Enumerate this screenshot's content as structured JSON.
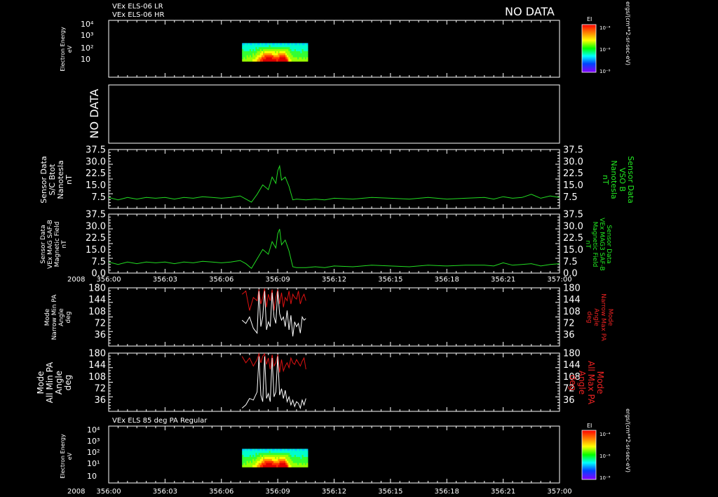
{
  "header": {
    "instrument_lines": [
      "VEx ELS-06 LR",
      "VEx ELS-06 HR"
    ],
    "status": "NO DATA"
  },
  "colors": {
    "frame": "#ffffff",
    "mag_trace": "#22dd22",
    "min_pa_trace": "#ffffff",
    "max_pa_trace": "#dd1111",
    "right_label_green": "#22ee22",
    "right_label_red": "#ee2222"
  },
  "time_axis": {
    "year": "2008",
    "tick_labels": [
      "356:00",
      "356:03",
      "356:06",
      "356:09",
      "356:12",
      "356:15",
      "356:18",
      "356:21",
      "357:00"
    ]
  },
  "chart_data": [
    {
      "type": "heatmap",
      "ylabel": [
        "Electron Energy",
        "eV"
      ],
      "y_tick_labels": [
        "10",
        "10²",
        "10³",
        "10⁴"
      ],
      "y_scale": "log",
      "colorbar": {
        "title": "EI",
        "tick_labels": [
          "10⁻⁴",
          "10⁻⁶",
          "10⁻⁸"
        ]
      },
      "colorbar_units": "ergs/(cm**2-sr-sec-eV)",
      "x_range": [
        "356:07.1",
        "356:10.6"
      ],
      "y_range_eV": [
        10,
        200
      ]
    },
    {
      "type": "line",
      "panel_text": "NO DATA"
    },
    {
      "type": "line",
      "left_label": [
        "Sensor Data",
        "S/C Btot",
        "Nanotesla",
        "nT"
      ],
      "right_label": [
        "Sensor Data",
        "VSO B",
        "Nanotesla",
        "nT"
      ],
      "y_tick_labels": [
        "37.5",
        "30.0",
        "22.5",
        "15.0",
        "7.5"
      ],
      "ylim": [
        0,
        37.5
      ],
      "series": [
        {
          "x_min": [
            0,
            0.5,
            1,
            1.5,
            2,
            2.5,
            3,
            3.5,
            4,
            4.5,
            5,
            5.5,
            6,
            6.5,
            7,
            7.3,
            7.6,
            7.9,
            8.2,
            8.5,
            8.7,
            8.9,
            9.0,
            9.1,
            9.2,
            9.4,
            9.6,
            9.8,
            10,
            10.5,
            11,
            11.5,
            12,
            13,
            14,
            15,
            16,
            17,
            18,
            19,
            20,
            20.5,
            21,
            21.5,
            22,
            22.5,
            23,
            23.5,
            24
          ],
          "values": [
            7,
            5.5,
            7,
            6,
            7,
            6.5,
            7,
            6,
            7,
            6.5,
            7.5,
            7,
            6.5,
            7,
            8,
            6,
            4,
            9,
            15,
            12,
            20,
            16,
            24,
            27,
            18,
            20,
            14,
            5.5,
            6,
            5.5,
            6,
            5.5,
            6.5,
            6,
            7,
            6.5,
            6,
            7,
            6,
            6.5,
            7,
            6,
            7.5,
            6.5,
            7,
            9,
            6.5,
            8,
            7
          ]
        }
      ]
    },
    {
      "type": "line",
      "left_label": [
        "Sensor Data",
        "VEx MAG SAF-B",
        "Magnetic Field",
        "nT"
      ],
      "right_label": [
        "Sensor Data",
        "VEx MAG3 SAF-B",
        "Magnetic Field",
        "nT"
      ],
      "y_tick_labels": [
        "37.5",
        "30.0",
        "22.5",
        "15.0",
        "7.5",
        "0.0"
      ],
      "ylim": [
        0,
        37.5
      ],
      "series": [
        {
          "x_min": [
            0,
            0.5,
            1,
            1.5,
            2,
            2.5,
            3,
            3.5,
            4,
            4.5,
            5,
            5.5,
            6,
            6.5,
            7,
            7.3,
            7.6,
            7.9,
            8.2,
            8.5,
            8.7,
            8.9,
            9.0,
            9.1,
            9.2,
            9.4,
            9.6,
            9.8,
            10,
            10.5,
            11,
            11.5,
            12,
            13,
            14,
            15,
            16,
            17,
            18,
            19,
            20,
            20.5,
            21,
            21.5,
            22,
            22.5,
            23,
            23.5,
            24
          ],
          "values": [
            7,
            5.5,
            7,
            6,
            7,
            6.5,
            7,
            6,
            7,
            6.5,
            7.5,
            7,
            6.5,
            7,
            8,
            6,
            3,
            9,
            15,
            12,
            20,
            16,
            25,
            28,
            18,
            21,
            14,
            4,
            3.5,
            3.5,
            4,
            3.5,
            4.5,
            4,
            5,
            4.5,
            4,
            5,
            4.5,
            5,
            5,
            4.5,
            6.5,
            5,
            5.5,
            6,
            4.5,
            5.5,
            6
          ]
        }
      ]
    },
    {
      "type": "line",
      "left_label": [
        "Mode",
        "Narrow Min PA",
        "Angle",
        "deg"
      ],
      "right_label": [
        "Mode",
        "Narrow Max PA",
        "Angle",
        "deg"
      ],
      "y_tick_labels": [
        "180",
        "144",
        "108",
        "72",
        "36"
      ],
      "ylim": [
        0,
        180
      ],
      "series": [
        {
          "x_min": [
            7.1,
            7.3,
            7.5,
            7.7,
            7.9,
            8.0,
            8.1,
            8.2,
            8.3,
            8.4,
            8.5,
            8.6,
            8.7,
            8.8,
            8.9,
            9.0,
            9.1,
            9.2,
            9.3,
            9.4,
            9.5,
            9.6,
            9.7,
            9.8,
            9.9,
            10.0,
            10.1,
            10.2,
            10.3,
            10.4,
            10.5
          ],
          "values": [
            80,
            70,
            90,
            55,
            40,
            170,
            60,
            90,
            170,
            50,
            75,
            60,
            165,
            90,
            70,
            170,
            100,
            80,
            90,
            60,
            110,
            50,
            95,
            30,
            75,
            60,
            70,
            40,
            90,
            80,
            85
          ]
        },
        {
          "x_min": [
            7.1,
            7.3,
            7.5,
            7.7,
            7.9,
            8.0,
            8.1,
            8.2,
            8.3,
            8.4,
            8.5,
            8.6,
            8.7,
            8.8,
            8.9,
            9.0,
            9.1,
            9.2,
            9.3,
            9.4,
            9.5,
            9.6,
            9.7,
            9.8,
            9.9,
            10.0,
            10.1,
            10.2,
            10.3,
            10.4,
            10.5
          ],
          "values": [
            160,
            170,
            110,
            150,
            140,
            175,
            130,
            150,
            178,
            120,
            160,
            140,
            175,
            110,
            150,
            175,
            130,
            165,
            120,
            150,
            140,
            170,
            130,
            160,
            150,
            145,
            170,
            130,
            150,
            160,
            140
          ]
        }
      ]
    },
    {
      "type": "line",
      "left_label": [
        "Mode",
        "All Min PA",
        "Angle",
        "deg"
      ],
      "right_label": [
        "Mode",
        "All Max PA",
        "Angle",
        "deg"
      ],
      "y_tick_labels": [
        "180",
        "144",
        "108",
        "72",
        "36"
      ],
      "ylim": [
        0,
        180
      ],
      "series": [
        {
          "x_min": [
            7.1,
            7.3,
            7.5,
            7.7,
            7.9,
            8.0,
            8.1,
            8.2,
            8.3,
            8.4,
            8.5,
            8.6,
            8.7,
            8.8,
            8.9,
            9.0,
            9.1,
            9.2,
            9.3,
            9.4,
            9.5,
            9.6,
            9.7,
            9.8,
            9.9,
            10.0,
            10.1,
            10.2,
            10.3,
            10.4,
            10.5
          ],
          "values": [
            10,
            20,
            40,
            35,
            60,
            170,
            50,
            30,
            170,
            40,
            55,
            30,
            165,
            45,
            60,
            170,
            50,
            70,
            40,
            65,
            30,
            45,
            20,
            35,
            15,
            30,
            25,
            10,
            35,
            20,
            40
          ]
        },
        {
          "x_min": [
            7.1,
            7.3,
            7.5,
            7.7,
            7.9,
            8.0,
            8.1,
            8.2,
            8.3,
            8.4,
            8.5,
            8.6,
            8.7,
            8.8,
            8.9,
            9.0,
            9.1,
            9.2,
            9.3,
            9.4,
            9.5,
            9.6,
            9.7,
            9.8,
            9.9,
            10.0,
            10.1,
            10.2,
            10.3,
            10.4,
            10.5
          ],
          "values": [
            170,
            150,
            165,
            140,
            160,
            178,
            150,
            170,
            178,
            145,
            165,
            130,
            175,
            140,
            150,
            175,
            120,
            160,
            125,
            140,
            150,
            135,
            165,
            150,
            145,
            160,
            150,
            140,
            155,
            165,
            130
          ]
        }
      ]
    },
    {
      "type": "heatmap",
      "title": "VEx ELS 85 deg PA Regular",
      "ylabel": [
        "Electron Energy",
        "eV"
      ],
      "y_tick_labels": [
        "10",
        "10¹",
        "10²",
        "10³",
        "10⁴"
      ],
      "y_scale": "log",
      "colorbar": {
        "title": "EI",
        "tick_labels": [
          "10⁻⁴",
          "10⁻⁶",
          "10⁻⁸"
        ]
      },
      "colorbar_units": "ergs/(cm**2-sr-sec-eV)",
      "x_range": [
        "356:07.1",
        "356:10.6"
      ],
      "y_range_eV": [
        10,
        200
      ]
    }
  ]
}
